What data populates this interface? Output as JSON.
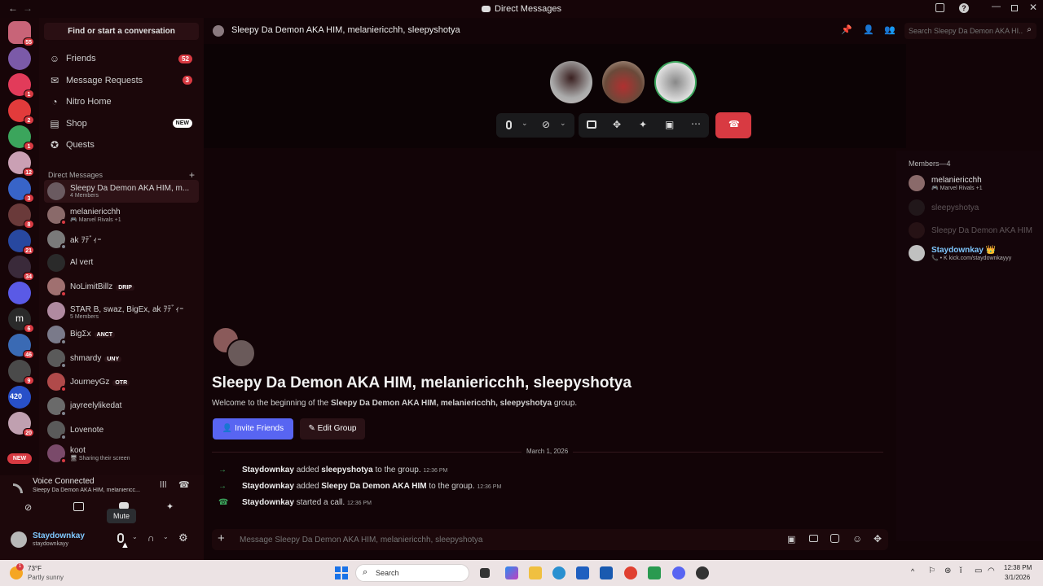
{
  "titlebar": {
    "title": "Direct Messages"
  },
  "servers": [
    {
      "badge": "55",
      "color": "#c86478"
    },
    {
      "badge": "",
      "color": "#7b5aa8"
    },
    {
      "badge": "1",
      "color": "#e23b5a"
    },
    {
      "badge": "2",
      "color": "#e23b3b"
    },
    {
      "badge": "1",
      "color": "#3ba55c"
    },
    {
      "badge": "12",
      "color": "#caa0b4"
    },
    {
      "badge": "3",
      "color": "#3864c8"
    },
    {
      "badge": "8",
      "color": "#6a3a3a"
    },
    {
      "badge": "21",
      "color": "#2848a0"
    },
    {
      "badge": "34",
      "color": "#3a2a3a"
    },
    {
      "badge": "",
      "color": "#5a5ae6"
    },
    {
      "badge": "6",
      "color": "#2a2a2a"
    },
    {
      "badge": "46",
      "color": "#3a6ab4"
    },
    {
      "badge": "9",
      "color": "#4a4a4a"
    },
    {
      "badge": "",
      "color": "#2850c8"
    },
    {
      "badge": "20",
      "color": "#c0a0b0"
    }
  ],
  "server_m_letter": "m",
  "server_420_label": "420",
  "server_new_label": "NEW",
  "dm": {
    "find": "Find or start a conversation",
    "nav": [
      {
        "label": "Friends",
        "icon": "person-wave-icon",
        "badge": "52"
      },
      {
        "label": "Message Requests",
        "icon": "envelope-icon",
        "badge": "3"
      },
      {
        "label": "Nitro Home",
        "icon": "nitro-icon",
        "badge": ""
      },
      {
        "label": "Shop",
        "icon": "shop-icon",
        "badge": "NEW"
      },
      {
        "label": "Quests",
        "icon": "compass-icon",
        "badge": ""
      }
    ],
    "header": "Direct Messages",
    "add_icon": "plus-icon",
    "items": [
      {
        "name": "Sleepy Da Demon AKA HIM, m...",
        "sub": "4 Members",
        "tag": "",
        "color": "#6a5a60",
        "status": ""
      },
      {
        "name": "melaniericchh",
        "sub": "🎮 Marvel Rivals +1",
        "tag": "",
        "color": "#8a6a6a",
        "status": "#d83a42"
      },
      {
        "name": "ak ｦﾃﾞｨｰ",
        "sub": "",
        "tag": "",
        "color": "#7a7a7a",
        "status": "#80848e"
      },
      {
        "name": "Al vert",
        "sub": "",
        "tag": "",
        "color": "#2a2a2a",
        "status": ""
      },
      {
        "name": "NoLimitBillz",
        "sub": "",
        "tag": "DRIP",
        "color": "#a07070",
        "status": "#d83a42"
      },
      {
        "name": "STAR B, swaz, BigEx, ak ｦﾃﾞｨｰ",
        "sub": "5 Members",
        "tag": "",
        "color": "#b08aa0",
        "status": ""
      },
      {
        "name": "BigΣx",
        "sub": "",
        "tag": "ANCT",
        "color": "#7a7a8a",
        "status": "#80848e"
      },
      {
        "name": "shmardy",
        "sub": "",
        "tag": "UNY",
        "color": "#5a5a5a",
        "status": "#80848e"
      },
      {
        "name": "JourneyGz",
        "sub": "",
        "tag": "OTR",
        "color": "#b04a4a",
        "status": "#d83a42"
      },
      {
        "name": "jayreelylikedat",
        "sub": "",
        "tag": "",
        "color": "#6a6a6a",
        "status": "#80848e"
      },
      {
        "name": "Lovenote",
        "sub": "",
        "tag": "",
        "color": "#5a5a5a",
        "status": "#80848e"
      },
      {
        "name": "koot",
        "sub": "🖥 Sharing their screen",
        "tag": "",
        "color": "#7a4a6a",
        "status": "#d83a42"
      }
    ]
  },
  "voice": {
    "status": "Voice Connected",
    "channel": "Sleepy Da Demon AKA HIM, melaniericc...",
    "tooltip": "Mute"
  },
  "user": {
    "name": "Staydownkay",
    "handle": "staydownkayy"
  },
  "chan": {
    "title": "Sleepy Da Demon AKA HIM, melaniericchh, sleepyshotya",
    "search_placeholder": "Search Sleepy Da Demon AKA HI..."
  },
  "intro": {
    "title": "Sleepy Da Demon AKA HIM, melaniericchh, sleepyshotya",
    "welcome_pre": "Welcome to the beginning of the ",
    "welcome_bold": "Sleepy Da Demon AKA HIM, melaniericchh, sleepyshotya",
    "welcome_post": " group.",
    "invite": "Invite Friends",
    "edit": "Edit Group"
  },
  "divider_date": "March 1, 2026",
  "messages": [
    {
      "icon": "arrow-right-icon",
      "user": "Staydownkay",
      "mid": " added ",
      "target": "sleepyshotya",
      "end": " to the group.",
      "time": "12:36 PM"
    },
    {
      "icon": "arrow-right-icon",
      "user": "Staydownkay",
      "mid": " added ",
      "target": "Sleepy Da Demon AKA HIM",
      "end": " to the group.",
      "time": "12:36 PM"
    },
    {
      "icon": "phone-icon",
      "user": "Staydownkay",
      "mid": " started a call.",
      "target": "",
      "end": "",
      "time": "12:36 PM"
    }
  ],
  "composer": {
    "placeholder": "Message Sleepy Da Demon AKA HIM, melaniericchh, sleepyshotya"
  },
  "members": {
    "header": "Members—4",
    "list": [
      {
        "name": "melaniericchh",
        "sub": "🎮 Marvel Rivals +1",
        "color": "#8a6a6a",
        "dim": false
      },
      {
        "name": "sleepyshotya",
        "sub": "",
        "color": "#3a3a3a",
        "dim": true
      },
      {
        "name": "Sleepy Da Demon AKA HIM",
        "sub": "",
        "color": "#4a2a2a",
        "dim": true
      },
      {
        "name": "Staydownkay 👑",
        "sub": "📞 • K kick.com/staydownkayyy",
        "color": "#c0c0c0",
        "dim": false
      }
    ]
  },
  "taskbar": {
    "temp": "73°F",
    "weather": "Partly sunny",
    "search": "Search",
    "time": "12:38 PM",
    "date": "3/1/2026",
    "weather_badge": "1"
  },
  "colors": {
    "accent": "#5865f2",
    "danger": "#d83a42",
    "bg": "#120407"
  }
}
